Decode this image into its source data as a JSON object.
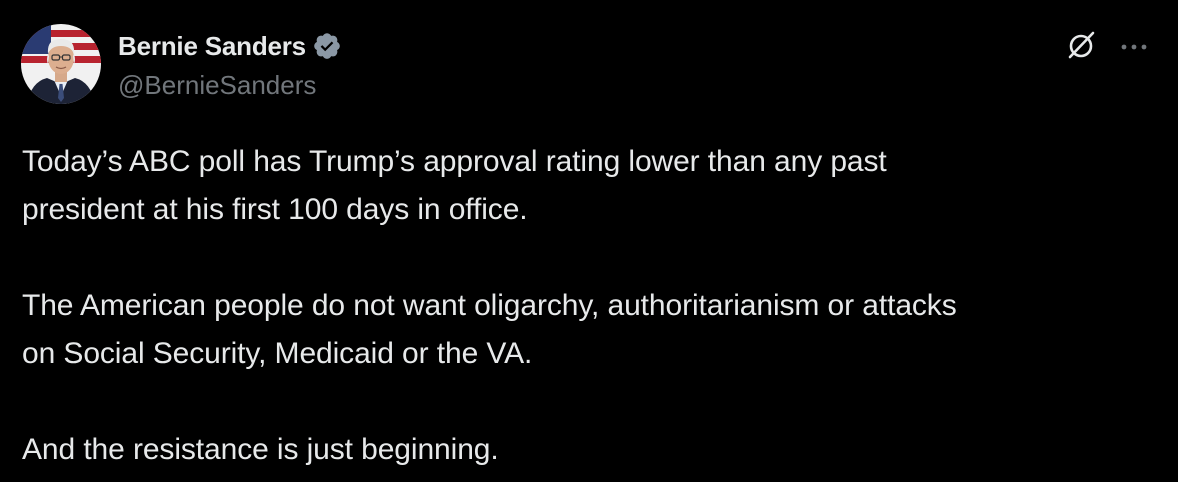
{
  "author": {
    "display_name": "Bernie Sanders",
    "handle": "@BernieSanders",
    "verified": true,
    "avatar_icon": "profile-photo"
  },
  "actions": {
    "grok_icon": "grok-icon",
    "more_icon": "more-icon"
  },
  "post": {
    "paragraphs": [
      {
        "line1": "Today’s ABC poll has Trump’s approval rating lower than any past",
        "line2": "president at his first 100 days in office."
      },
      {
        "line1": "The American people do not want oligarchy, authoritarianism or attacks",
        "line2": "on Social Security, Medicaid or the VA."
      },
      {
        "line1": "And the resistance is just beginning."
      }
    ]
  },
  "colors": {
    "background": "#000000",
    "primary_text": "#e7e9ea",
    "secondary_text": "#71767b",
    "verified_badge": "#8b98a5"
  }
}
